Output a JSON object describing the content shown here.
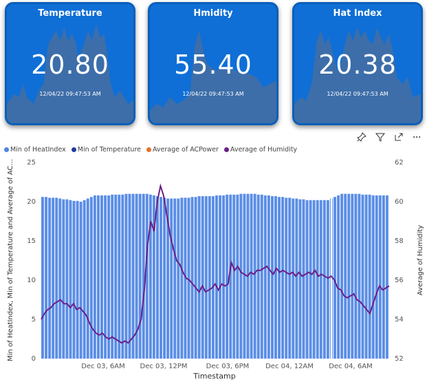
{
  "cards": [
    {
      "title": "Temperature",
      "value": "20.80",
      "timestamp": "12/04/22 09:47:53 AM"
    },
    {
      "title": "Hmidity",
      "value": "55.40",
      "timestamp": "12/04/22 09:47:53 AM"
    },
    {
      "title": "Hat Index",
      "value": "20.38",
      "timestamp": "12/04/22 09:47:53 AM"
    }
  ],
  "toolbar": {
    "icons": [
      "pin-icon",
      "filter-icon",
      "focus-mode-icon",
      "more-options-icon"
    ],
    "more_label": "···"
  },
  "legend": [
    {
      "label": "Min of HeatIndex",
      "color": "#4f86e0"
    },
    {
      "label": "Min of Temperature",
      "color": "#1f3c9c"
    },
    {
      "label": "Average of ACPower",
      "color": "#e8702a"
    },
    {
      "label": "Average of Humidity",
      "color": "#6b1f86"
    }
  ],
  "chart_data": {
    "type": "bar",
    "title": "",
    "xlabel": "Timestamp",
    "ylabel": "Min of HeatIndex, Min of Temperature and Average of AC...",
    "y2label": "Average of Humidity",
    "ylim": [
      0,
      25
    ],
    "y2lim": [
      52,
      62
    ],
    "yticks": [
      "0",
      "5",
      "10",
      "15",
      "20",
      "25"
    ],
    "y2ticks": [
      "52",
      "54",
      "56",
      "58",
      "60",
      "62"
    ],
    "xticks": [
      "Dec 03, 6AM",
      "Dec 03, 12PM",
      "Dec 03, 6PM",
      "Dec 04, 12AM",
      "Dec 04, 6AM"
    ],
    "bar_series": [
      {
        "name": "Min of HeatIndex",
        "values": [
          20.6,
          20.6,
          20.5,
          20.5,
          20.5,
          20.4,
          20.3,
          20.3,
          20.2,
          20.1,
          20.1,
          20.0,
          20.2,
          20.4,
          20.6,
          20.8,
          20.8,
          20.8,
          20.8,
          20.8,
          20.9,
          20.9,
          20.9,
          20.9,
          21.0,
          21.0,
          21.0,
          21.0,
          21.0,
          21.0,
          21.0,
          20.9,
          20.8,
          20.7,
          20.6,
          20.5,
          20.4,
          20.4,
          20.4,
          20.4,
          20.5,
          20.5,
          20.5,
          20.6,
          20.6,
          20.7,
          20.7,
          20.7,
          20.7,
          20.7,
          20.8,
          20.8,
          20.8,
          20.9,
          20.9,
          20.9,
          20.9,
          21.0,
          21.0,
          21.0,
          21.0,
          21.0,
          20.9,
          20.9,
          20.8,
          20.8,
          20.7,
          20.7,
          20.6,
          20.6,
          20.5,
          20.5,
          20.4,
          20.4,
          20.3,
          20.3,
          20.2,
          20.2,
          20.2,
          20.2,
          20.2,
          20.2,
          20.2,
          20.4,
          20.6,
          20.8,
          21.0,
          21.0,
          21.0,
          21.0,
          21.0,
          21.0,
          20.9,
          20.9,
          20.9,
          20.8,
          20.8,
          20.8,
          20.8,
          20.8
        ]
      }
    ],
    "line_series": [
      {
        "name": "Average of Humidity",
        "values": [
          54.0,
          54.3,
          54.5,
          54.6,
          54.8,
          54.9,
          55.0,
          54.8,
          54.8,
          54.6,
          54.8,
          54.5,
          54.6,
          54.4,
          54.2,
          53.8,
          53.5,
          53.3,
          53.2,
          53.3,
          53.1,
          53.0,
          53.1,
          53.0,
          52.9,
          52.8,
          52.9,
          52.8,
          53.0,
          53.2,
          53.5,
          54.0,
          55.5,
          57.8,
          59.0,
          58.5,
          60.0,
          60.8,
          60.3,
          59.3,
          58.3,
          57.6,
          57.0,
          56.8,
          56.4,
          56.1,
          56.0,
          55.8,
          55.6,
          55.4,
          55.7,
          55.4,
          55.5,
          55.6,
          55.8,
          55.5,
          55.8,
          55.7,
          55.8,
          56.9,
          56.5,
          56.7,
          56.4,
          56.3,
          56.2,
          56.4,
          56.3,
          56.5,
          56.5,
          56.6,
          56.7,
          56.5,
          56.3,
          56.6,
          56.4,
          56.5,
          56.4,
          56.3,
          56.4,
          56.2,
          56.4,
          56.2,
          56.3,
          56.4,
          56.3,
          56.5,
          56.2,
          56.3,
          56.2,
          56.1,
          56.2,
          56.0,
          55.6,
          55.5,
          55.2,
          55.1,
          55.2,
          55.3,
          55.0,
          54.9,
          54.7,
          54.5,
          54.3,
          54.8,
          55.3,
          55.7,
          55.5,
          55.6,
          55.7
        ]
      }
    ]
  }
}
